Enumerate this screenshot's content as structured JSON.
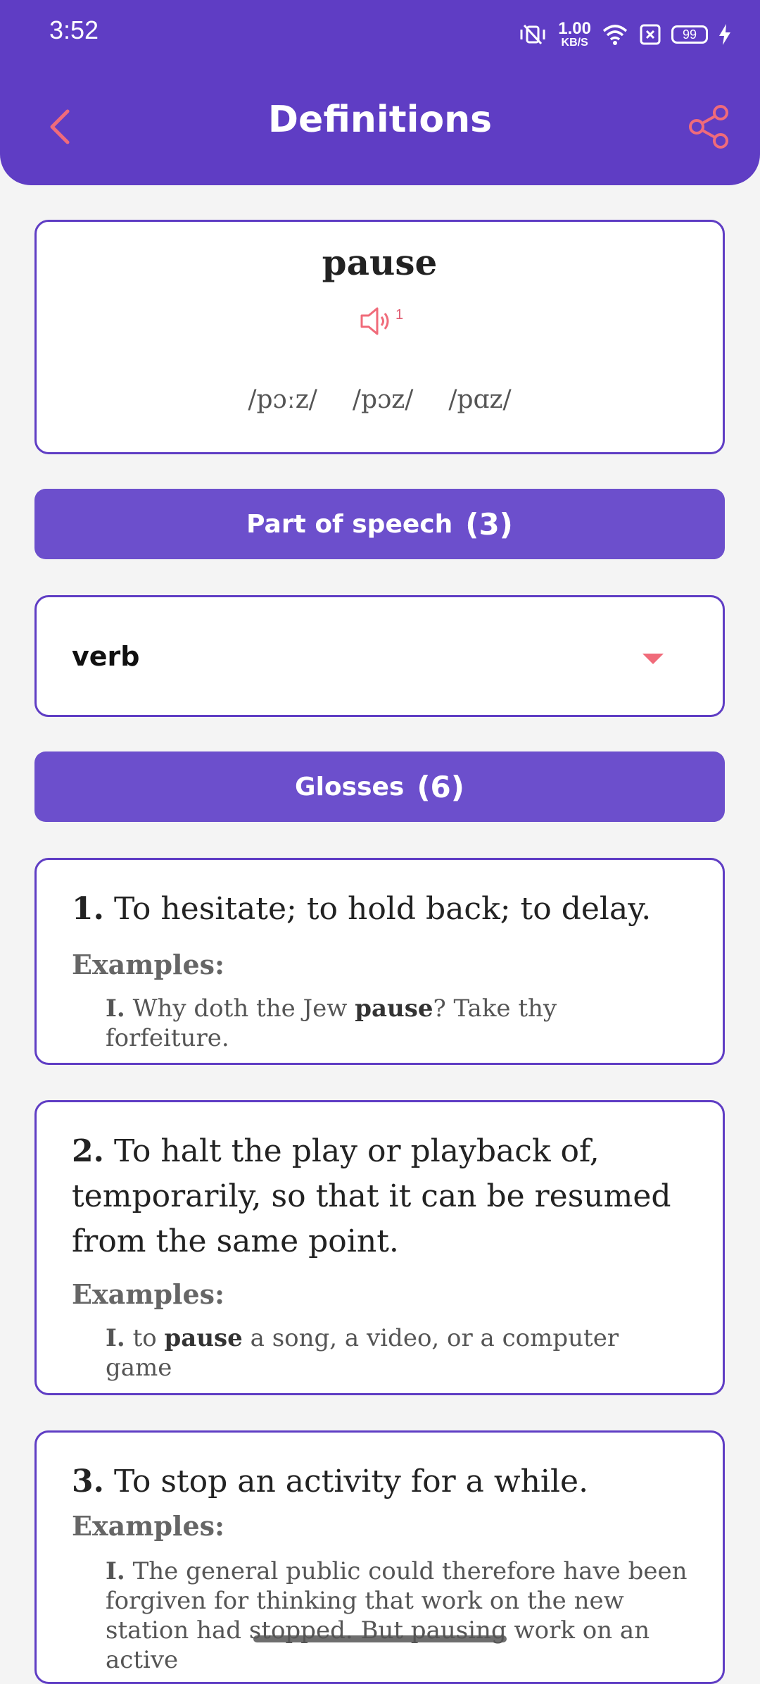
{
  "status": {
    "time": "3:52",
    "net_speed": "1.00",
    "net_unit": "KB/S",
    "battery": "99",
    "icons": [
      "vibrate-icon",
      "wifi-icon",
      "close-box-icon",
      "battery-icon",
      "charging-icon"
    ]
  },
  "header": {
    "title": "Definitions",
    "back_icon": "chevron-left-icon",
    "share_icon": "share-icon"
  },
  "word_card": {
    "word": "pause",
    "audio_count": "1",
    "pronunciations": [
      "/pɔːz/",
      "/pɔz/",
      "/pɑz/"
    ]
  },
  "part_of_speech": {
    "label": "Part of speech",
    "count": "(3)",
    "selected": "verb"
  },
  "glosses": {
    "label": "Glosses",
    "count": "(6)",
    "examples_label": "Examples:",
    "items": [
      {
        "num": "1.",
        "text": "To hesitate; to hold back; to delay.",
        "example_index": "I.",
        "example_before": "Why doth the Jew ",
        "example_keyword": "pause",
        "example_after": "? Take thy forfeiture."
      },
      {
        "num": "2.",
        "text": "To halt the play or playback of, temporarily, so that it can be resumed from the same point.",
        "example_index": "I.",
        "example_before": "to ",
        "example_keyword": "pause",
        "example_after": " a song, a video, or a computer game"
      },
      {
        "num": "3.",
        "text": "To stop an activity for a while.",
        "example_index": "I.",
        "example_before": "The general public could therefore have been forgiven for thinking that work on the new station had stopped. But pausing work on an active",
        "example_keyword": "",
        "example_after": ""
      }
    ]
  },
  "colors": {
    "primary": "#5f3dc4",
    "section": "#6c4fcc",
    "accent": "#f06b7a",
    "background": "#f4f4f4"
  }
}
